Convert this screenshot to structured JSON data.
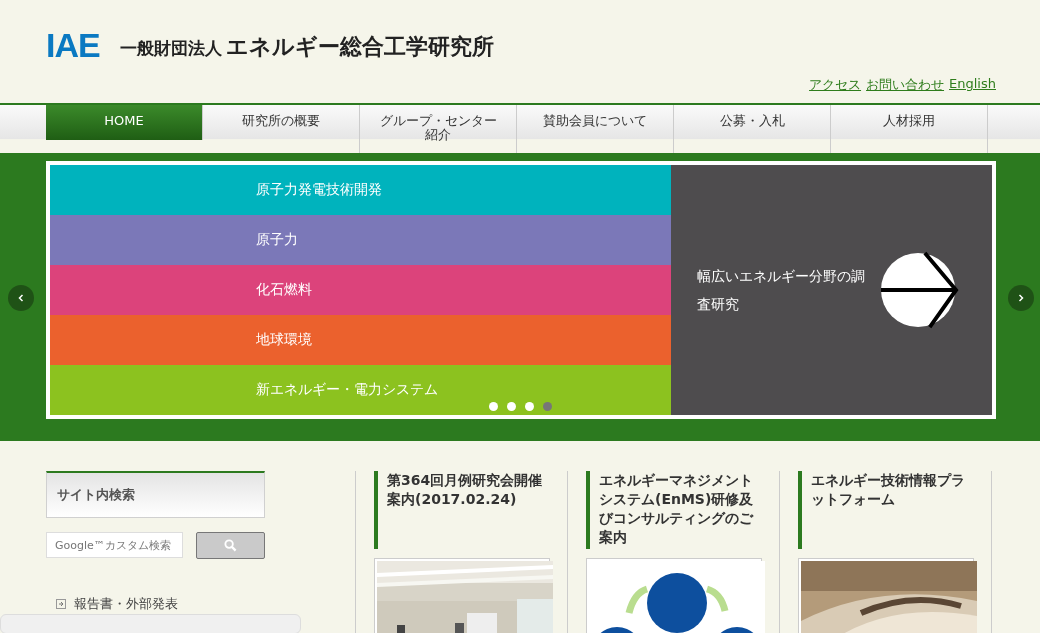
{
  "header": {
    "logo": "IAE",
    "org_type": "一般財団法人",
    "org_name": "エネルギー総合工学研究所",
    "links": [
      "アクセス",
      "お問い合わせ",
      "English"
    ]
  },
  "nav": [
    {
      "label": "HOME",
      "selected": true
    },
    {
      "label": "研究所の概要",
      "selected": false
    },
    {
      "label": "グループ・センター紹介",
      "selected": false
    },
    {
      "label": "賛助会員について",
      "selected": false
    },
    {
      "label": "公募・入札",
      "selected": false
    },
    {
      "label": "人材採用",
      "selected": false
    }
  ],
  "slider": {
    "items": [
      {
        "label": "原子力発電技術開発",
        "color": "#00b3bd"
      },
      {
        "label": "原子力",
        "color": "#7b78b8"
      },
      {
        "label": "化石燃料",
        "color": "#dc437b"
      },
      {
        "label": "地球環境",
        "color": "#eb612d"
      },
      {
        "label": "新エネルギー・電力システム",
        "color": "#8cc21f"
      }
    ],
    "feature": "幅広いエネルギー分野の調査研究",
    "dots": [
      {
        "selected": false
      },
      {
        "selected": false
      },
      {
        "selected": false
      },
      {
        "selected": true
      }
    ]
  },
  "sidebar": {
    "search_title": "サイト内検索",
    "search_placeholder": "Google™カスタム検索",
    "links": [
      "報告書・外部発表"
    ]
  },
  "news": [
    {
      "title": "第364回月例研究会開催案内(2017.02.24)",
      "kind": "picture"
    },
    {
      "title": "エネルギーマネジメントシステム(EnMS)研修及びコンサルティングのご案内",
      "kind": "picture"
    },
    {
      "title": "エネルギー技術情報プラットフォーム",
      "kind": "picture"
    }
  ]
}
